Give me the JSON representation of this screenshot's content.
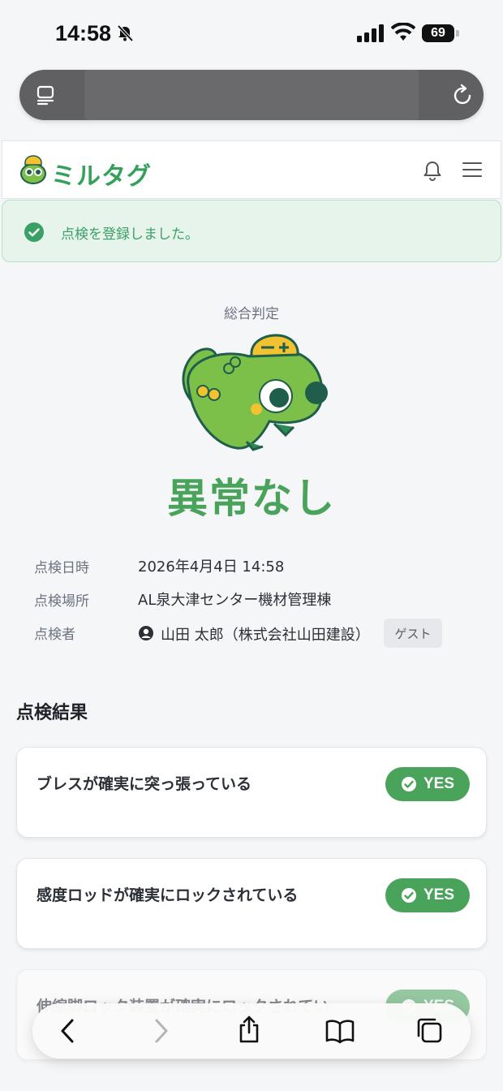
{
  "status_bar": {
    "time": "14:58",
    "battery": "69"
  },
  "header": {
    "logo_text": "ミルタグ"
  },
  "alert": {
    "message": "点検を登録しました。"
  },
  "judgement": {
    "label": "総合判定",
    "result": "異常なし"
  },
  "info": {
    "date_label": "点検日時",
    "date_value": "2026年4月4日 14:58",
    "place_label": "点検場所",
    "place_value": "AL泉大津センター機材管理棟",
    "inspector_label": "点検者",
    "inspector_value": "山田 太郎（株式会社山田建設）",
    "guest_badge": "ゲスト"
  },
  "results": {
    "title": "点検結果",
    "items": [
      {
        "text": "ブレスが確実に突っ張っている",
        "answer": "YES"
      },
      {
        "text": "感度ロッドが確実にロックされている",
        "answer": "YES"
      },
      {
        "text": "伸縮脚ロック装置が確実にロックされてい",
        "answer": "YES"
      }
    ]
  },
  "colors": {
    "brand_green": "#4aa35a",
    "alert_bg": "#e6f4ec",
    "alert_text": "#3aa066"
  }
}
